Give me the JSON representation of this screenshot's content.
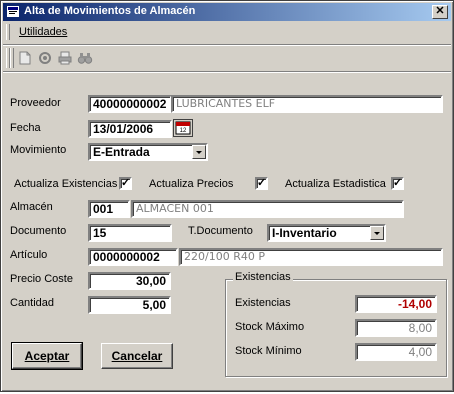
{
  "window": {
    "title": "Alta de Movimientos de Almacén",
    "close_label": "✕"
  },
  "menu": {
    "items": [
      {
        "label": "Utilidades"
      }
    ]
  },
  "toolbar": {
    "icons": [
      "new-document-icon",
      "view-icon",
      "print-icon",
      "find-icon"
    ]
  },
  "form": {
    "proveedor": {
      "label": "Proveedor",
      "code": "40000000002",
      "name": "LUBRICANTES ELF"
    },
    "fecha": {
      "label": "Fecha",
      "value": "13/01/2006",
      "calendar_text": "12"
    },
    "movimiento": {
      "label": "Movimiento",
      "value": "E-Entrada"
    },
    "checks": {
      "existencias": {
        "label": "Actualiza Existencias",
        "checked": "✓"
      },
      "precios": {
        "label": "Actualiza Precios",
        "checked": "✓"
      },
      "estadistica": {
        "label": "Actualiza Estadistica",
        "checked": "✓"
      }
    },
    "almacen": {
      "label": "Almacén",
      "code": "001",
      "name": "ALMACEN 001"
    },
    "documento": {
      "label": "Documento",
      "value": "15"
    },
    "tdocumento": {
      "label": "T.Documento",
      "value": "I-Inventario"
    },
    "articulo": {
      "label": "Artículo",
      "code": "0000000002",
      "name": "220/100 R40 P"
    },
    "precio_coste": {
      "label": "Precio Coste",
      "value": "30,00"
    },
    "cantidad": {
      "label": "Cantidad",
      "value": "5,00"
    }
  },
  "existencias_group": {
    "title": "Existencias",
    "existencias": {
      "label": "Existencias",
      "value": "-14,00"
    },
    "stock_maximo": {
      "label": "Stock Máximo",
      "value": "8,00"
    },
    "stock_minimo": {
      "label": "Stock Mínimo",
      "value": "4,00"
    }
  },
  "buttons": {
    "accept": {
      "label": "Aceptar"
    },
    "cancel": {
      "label": "Cancelar"
    }
  },
  "colors": {
    "titlebar_start": "#0a246a",
    "titlebar_end": "#a6caf0",
    "face": "#d4d0c8",
    "negative": "#b00000"
  }
}
